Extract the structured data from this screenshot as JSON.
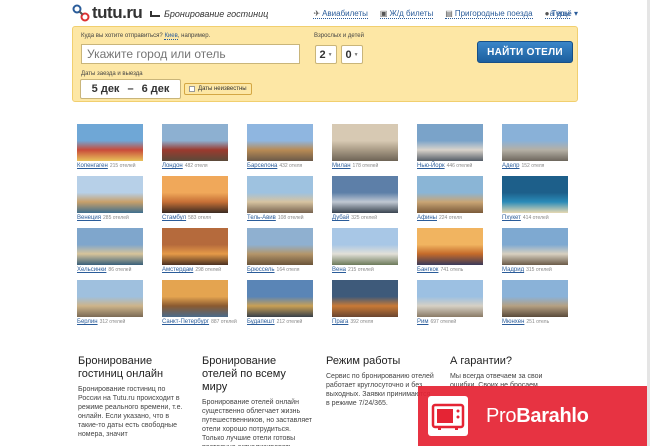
{
  "header": {
    "logo": "tutu.ru",
    "section_title": "Бронирование гостиниц",
    "nav": [
      {
        "label": "Авиабилеты",
        "icon": "plane-icon"
      },
      {
        "label": "Ж/д билеты",
        "icon": "train-icon"
      },
      {
        "label": "Пригородные поезда",
        "icon": "suburban-train-icon"
      },
      {
        "label": "Туры",
        "icon": "pin-icon"
      }
    ],
    "more": "а ещё"
  },
  "search": {
    "where_label": "Куда вы хотите отправиться?",
    "example_link": "Киев",
    "example_suffix": ", например.",
    "city_placeholder": "Укажите город или отель",
    "adults_label": "Взрослых и детей",
    "adults": "2",
    "children": "0",
    "find_button": "НАЙТИ ОТЕЛИ",
    "dates_label": "Даты заезда и выезда",
    "date_from": "5 дек",
    "date_sep": "–",
    "date_to": "6 дек",
    "dates_unknown": "Даты неизвестны"
  },
  "cities": [
    {
      "name": "Копенгаген",
      "count": "215 отелей"
    },
    {
      "name": "Лондон",
      "count": "482 отеля"
    },
    {
      "name": "Барселона",
      "count": "432 отеля"
    },
    {
      "name": "Милан",
      "count": "178 отелей"
    },
    {
      "name": "Нью-Йорк",
      "count": "446 отелей"
    },
    {
      "name": "Аделр",
      "count": "152 отеля"
    },
    {
      "name": "Венеция",
      "count": "285 отелей"
    },
    {
      "name": "Стамбул",
      "count": "583 отеля"
    },
    {
      "name": "Тель-Авив",
      "count": "108 отелей"
    },
    {
      "name": "Дубай",
      "count": "325 отелей"
    },
    {
      "name": "Афины",
      "count": "224 отеля"
    },
    {
      "name": "Пхукет",
      "count": "414 отелей"
    },
    {
      "name": "Хельсинки",
      "count": "86 отелей"
    },
    {
      "name": "Амстердам",
      "count": "298 отелей"
    },
    {
      "name": "Брюссель",
      "count": "164 отеля"
    },
    {
      "name": "Вена",
      "count": "215 отелей"
    },
    {
      "name": "Бангкок",
      "count": "741 отель"
    },
    {
      "name": "Мадрид",
      "count": "315 отелей"
    },
    {
      "name": "Берлин",
      "count": "312 отелей"
    },
    {
      "name": "Санкт-Петербург",
      "count": "887 отелей"
    },
    {
      "name": "Будапешт",
      "count": "212 отелей"
    },
    {
      "name": "Прага",
      "count": "392 отеля"
    },
    {
      "name": "Рим",
      "count": "697 отелей"
    },
    {
      "name": "Мюнхен",
      "count": "251 отель"
    }
  ],
  "info": [
    {
      "title": "Бронирование гостиниц онлайн",
      "text": "Бронирование гостиниц по России на Tutu.ru происходит в режиме реального времени, т.е. онлайн. Если указано, что в такие-то даты есть свободные номера, значит"
    },
    {
      "title": "Бронирование отелей по всему миру",
      "text": "Бронирование отелей онлайн существенно облегчает жизнь путешественников, но заставляет отели хорошо потрудиться. Только лучшие отели готовы постоянно актуализировать информацию"
    },
    {
      "title": "Режим работы",
      "text": "Сервис по бронированию отелей работает круглосуточно и без выходных. Заявки принимаются в режиме 7/24/365."
    },
    {
      "title": "А гарантии?",
      "text": "Мы всегда отвечаем за свои ошибки. Своих не бросаем."
    }
  ],
  "watermark": {
    "part1": "Pro",
    "part2": "Barahlo"
  }
}
